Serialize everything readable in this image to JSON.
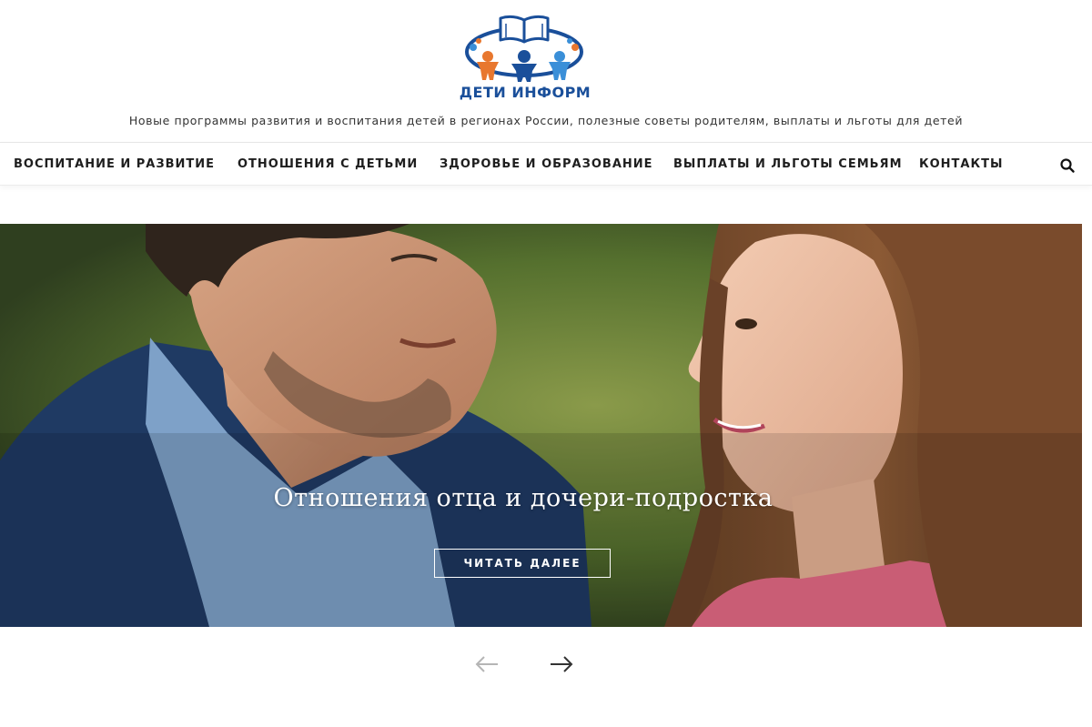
{
  "header": {
    "logo_text": "ДЕТИ ИНФОРМ",
    "tagline": "Новые программы развития и воспитания детей в регионах России, полезные советы родителям, выплаты и льготы для детей"
  },
  "nav": {
    "items": [
      {
        "label": "ВОСПИТАНИЕ И РАЗВИТИЕ"
      },
      {
        "label": "ОТНОШЕНИЯ С ДЕТЬМИ"
      },
      {
        "label": "ЗДОРОВЬЕ И ОБРАЗОВАНИЕ"
      },
      {
        "label": "ВЫПЛАТЫ И ЛЬГОТЫ СЕМЬЯМ"
      },
      {
        "label": "КОНТАКТЫ"
      }
    ],
    "search_icon": "search-icon"
  },
  "slider": {
    "title": "Отношения отца и дочери-подростка",
    "button_label": "ЧИТАТЬ ДАЛЕЕ",
    "prev_icon": "arrow-left-icon",
    "next_icon": "arrow-right-icon"
  },
  "colors": {
    "brand_blue": "#1a4f9a",
    "logo_orange": "#e8772e",
    "logo_light_blue": "#3a8fd8",
    "text_dark": "#1e1e1e"
  }
}
